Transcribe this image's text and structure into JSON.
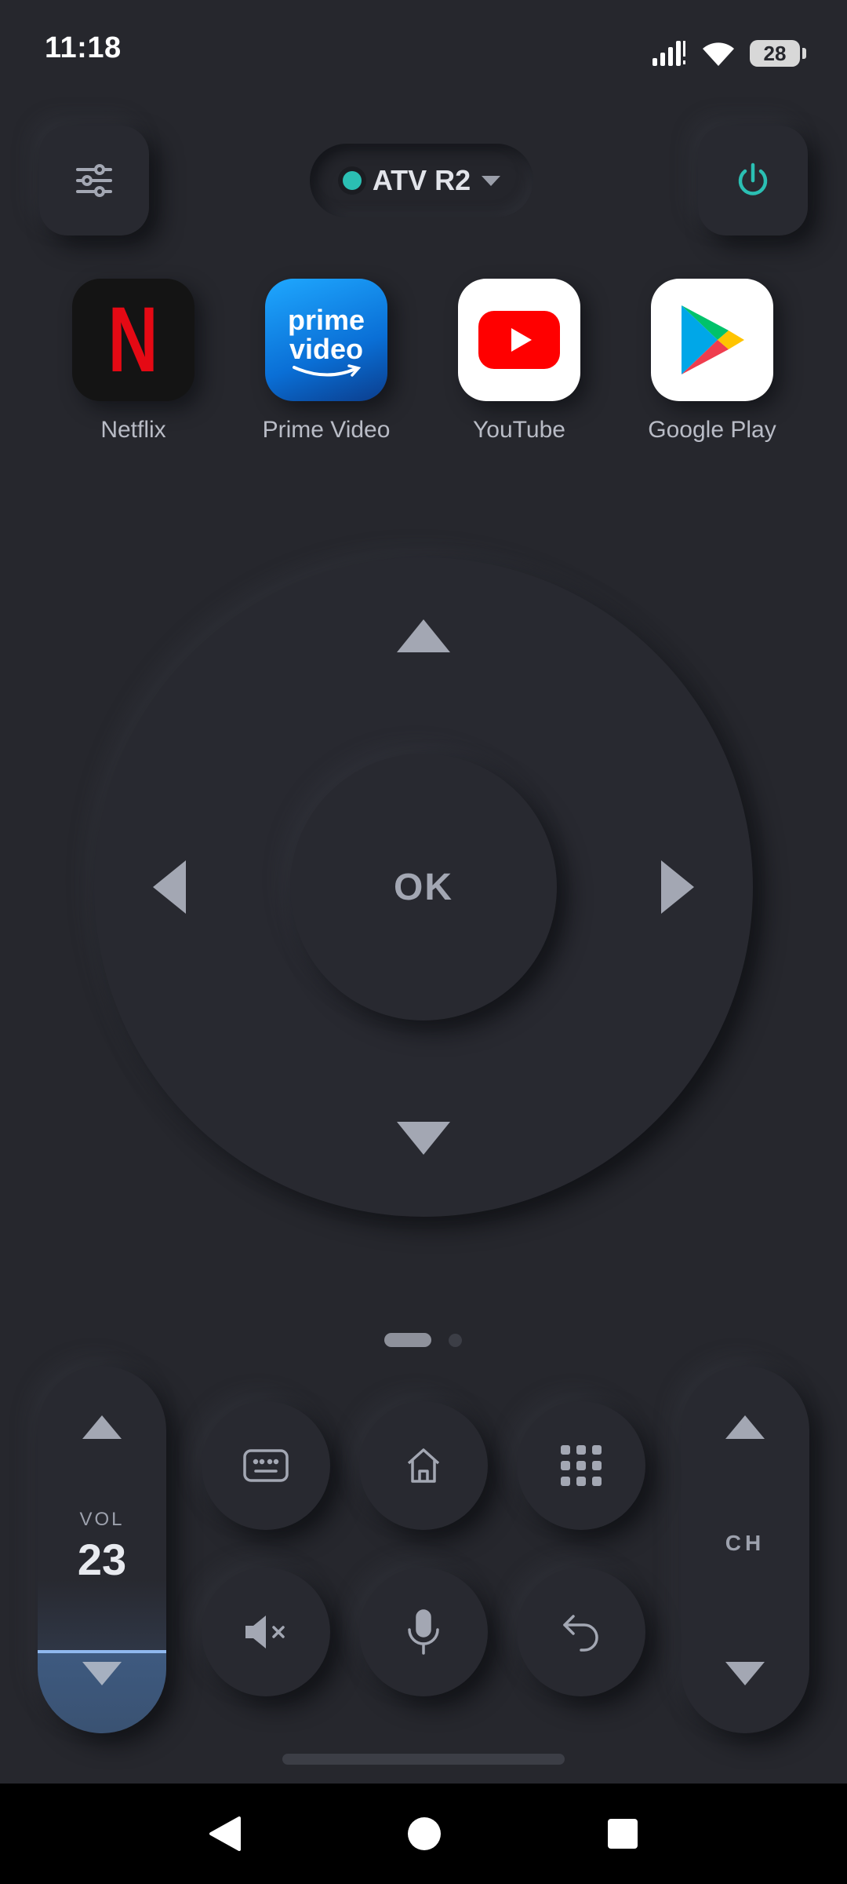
{
  "status_bar": {
    "time": "11:18",
    "battery": "28"
  },
  "header": {
    "device_name": "ATV R2",
    "connected_color": "#2bbfb3"
  },
  "apps": [
    {
      "label": "Netflix",
      "brand_letter": "N",
      "color": "#e50914"
    },
    {
      "label": "Prime Video",
      "line1": "prime",
      "line2": "video",
      "color": "#1a98ff"
    },
    {
      "label": "YouTube",
      "color": "#ff0000"
    },
    {
      "label": "Google Play"
    }
  ],
  "dpad": {
    "ok_label": "OK"
  },
  "pager": {
    "pages": 2,
    "current": 1
  },
  "volume": {
    "label": "VOL",
    "value": "23",
    "level_fraction": 0.23,
    "accent": "#8fb8ee"
  },
  "channel": {
    "label": "CH"
  },
  "buttons": [
    "keyboard-icon",
    "home-icon",
    "apps-grid-icon",
    "mute-icon",
    "microphone-icon",
    "back-icon"
  ]
}
